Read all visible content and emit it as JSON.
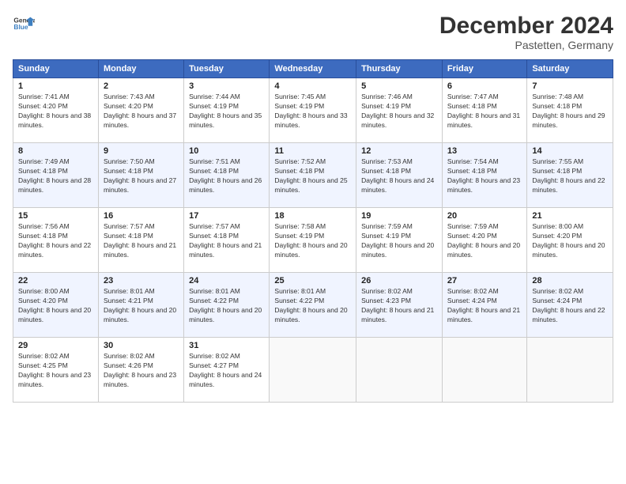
{
  "header": {
    "month_title": "December 2024",
    "location": "Pastetten, Germany"
  },
  "calendar": {
    "columns": [
      "Sunday",
      "Monday",
      "Tuesday",
      "Wednesday",
      "Thursday",
      "Friday",
      "Saturday"
    ],
    "rows": [
      [
        {
          "day": "1",
          "sunrise": "7:41 AM",
          "sunset": "4:20 PM",
          "daylight": "8 hours and 38 minutes."
        },
        {
          "day": "2",
          "sunrise": "7:43 AM",
          "sunset": "4:20 PM",
          "daylight": "8 hours and 37 minutes."
        },
        {
          "day": "3",
          "sunrise": "7:44 AM",
          "sunset": "4:19 PM",
          "daylight": "8 hours and 35 minutes."
        },
        {
          "day": "4",
          "sunrise": "7:45 AM",
          "sunset": "4:19 PM",
          "daylight": "8 hours and 33 minutes."
        },
        {
          "day": "5",
          "sunrise": "7:46 AM",
          "sunset": "4:19 PM",
          "daylight": "8 hours and 32 minutes."
        },
        {
          "day": "6",
          "sunrise": "7:47 AM",
          "sunset": "4:18 PM",
          "daylight": "8 hours and 31 minutes."
        },
        {
          "day": "7",
          "sunrise": "7:48 AM",
          "sunset": "4:18 PM",
          "daylight": "8 hours and 29 minutes."
        }
      ],
      [
        {
          "day": "8",
          "sunrise": "7:49 AM",
          "sunset": "4:18 PM",
          "daylight": "8 hours and 28 minutes."
        },
        {
          "day": "9",
          "sunrise": "7:50 AM",
          "sunset": "4:18 PM",
          "daylight": "8 hours and 27 minutes."
        },
        {
          "day": "10",
          "sunrise": "7:51 AM",
          "sunset": "4:18 PM",
          "daylight": "8 hours and 26 minutes."
        },
        {
          "day": "11",
          "sunrise": "7:52 AM",
          "sunset": "4:18 PM",
          "daylight": "8 hours and 25 minutes."
        },
        {
          "day": "12",
          "sunrise": "7:53 AM",
          "sunset": "4:18 PM",
          "daylight": "8 hours and 24 minutes."
        },
        {
          "day": "13",
          "sunrise": "7:54 AM",
          "sunset": "4:18 PM",
          "daylight": "8 hours and 23 minutes."
        },
        {
          "day": "14",
          "sunrise": "7:55 AM",
          "sunset": "4:18 PM",
          "daylight": "8 hours and 22 minutes."
        }
      ],
      [
        {
          "day": "15",
          "sunrise": "7:56 AM",
          "sunset": "4:18 PM",
          "daylight": "8 hours and 22 minutes."
        },
        {
          "day": "16",
          "sunrise": "7:57 AM",
          "sunset": "4:18 PM",
          "daylight": "8 hours and 21 minutes."
        },
        {
          "day": "17",
          "sunrise": "7:57 AM",
          "sunset": "4:18 PM",
          "daylight": "8 hours and 21 minutes."
        },
        {
          "day": "18",
          "sunrise": "7:58 AM",
          "sunset": "4:19 PM",
          "daylight": "8 hours and 20 minutes."
        },
        {
          "day": "19",
          "sunrise": "7:59 AM",
          "sunset": "4:19 PM",
          "daylight": "8 hours and 20 minutes."
        },
        {
          "day": "20",
          "sunrise": "7:59 AM",
          "sunset": "4:20 PM",
          "daylight": "8 hours and 20 minutes."
        },
        {
          "day": "21",
          "sunrise": "8:00 AM",
          "sunset": "4:20 PM",
          "daylight": "8 hours and 20 minutes."
        }
      ],
      [
        {
          "day": "22",
          "sunrise": "8:00 AM",
          "sunset": "4:20 PM",
          "daylight": "8 hours and 20 minutes."
        },
        {
          "day": "23",
          "sunrise": "8:01 AM",
          "sunset": "4:21 PM",
          "daylight": "8 hours and 20 minutes."
        },
        {
          "day": "24",
          "sunrise": "8:01 AM",
          "sunset": "4:22 PM",
          "daylight": "8 hours and 20 minutes."
        },
        {
          "day": "25",
          "sunrise": "8:01 AM",
          "sunset": "4:22 PM",
          "daylight": "8 hours and 20 minutes."
        },
        {
          "day": "26",
          "sunrise": "8:02 AM",
          "sunset": "4:23 PM",
          "daylight": "8 hours and 21 minutes."
        },
        {
          "day": "27",
          "sunrise": "8:02 AM",
          "sunset": "4:24 PM",
          "daylight": "8 hours and 21 minutes."
        },
        {
          "day": "28",
          "sunrise": "8:02 AM",
          "sunset": "4:24 PM",
          "daylight": "8 hours and 22 minutes."
        }
      ],
      [
        {
          "day": "29",
          "sunrise": "8:02 AM",
          "sunset": "4:25 PM",
          "daylight": "8 hours and 23 minutes."
        },
        {
          "day": "30",
          "sunrise": "8:02 AM",
          "sunset": "4:26 PM",
          "daylight": "8 hours and 23 minutes."
        },
        {
          "day": "31",
          "sunrise": "8:02 AM",
          "sunset": "4:27 PM",
          "daylight": "8 hours and 24 minutes."
        },
        null,
        null,
        null,
        null
      ]
    ]
  }
}
